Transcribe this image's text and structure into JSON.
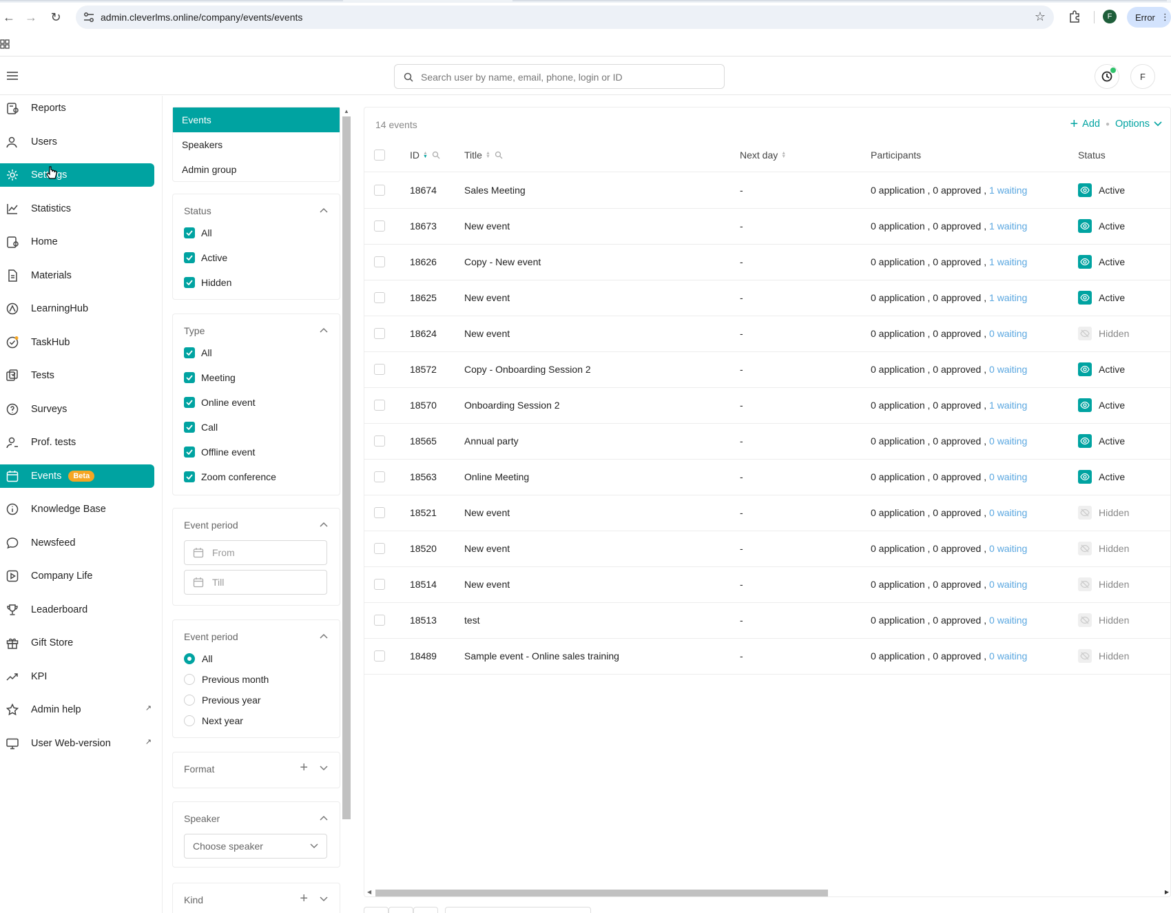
{
  "browser": {
    "url": "admin.cleverlms.online/company/events/events",
    "profile_initial": "F",
    "error_label": "Error"
  },
  "header": {
    "search_placeholder": "Search user by name, email, phone, login or ID",
    "user_initial": "F"
  },
  "sidebar": {
    "items": [
      {
        "label": "Reports",
        "icon": "reports-icon"
      },
      {
        "label": "Users",
        "icon": "users-icon"
      },
      {
        "label": "Settings",
        "icon": "gear-icon"
      },
      {
        "label": "Statistics",
        "icon": "statistics-icon"
      },
      {
        "label": "Home",
        "icon": "home-icon"
      },
      {
        "label": "Materials",
        "icon": "materials-icon"
      },
      {
        "label": "LearningHub",
        "icon": "learninghub-icon"
      },
      {
        "label": "TaskHub",
        "icon": "taskhub-icon"
      },
      {
        "label": "Tests",
        "icon": "tests-icon"
      },
      {
        "label": "Surveys",
        "icon": "surveys-icon"
      },
      {
        "label": "Prof. tests",
        "icon": "prof-tests-icon"
      },
      {
        "label": "Events",
        "icon": "calendar-icon",
        "badge": "Beta"
      },
      {
        "label": "Knowledge Base",
        "icon": "info-icon"
      },
      {
        "label": "Newsfeed",
        "icon": "chat-icon"
      },
      {
        "label": "Company Life",
        "icon": "play-icon"
      },
      {
        "label": "Leaderboard",
        "icon": "trophy-icon"
      },
      {
        "label": "Gift Store",
        "icon": "gift-icon"
      },
      {
        "label": "KPI",
        "icon": "trend-icon"
      },
      {
        "label": "Admin help",
        "icon": "star-icon",
        "external": true
      },
      {
        "label": "User Web-version",
        "icon": "monitor-icon",
        "external": true
      }
    ]
  },
  "filters": {
    "tabs": [
      "Events",
      "Speakers",
      "Admin group"
    ],
    "status": {
      "title": "Status",
      "options": [
        "All",
        "Active",
        "Hidden"
      ]
    },
    "type": {
      "title": "Type",
      "options": [
        "All",
        "Meeting",
        "Online event",
        "Call",
        "Offline event",
        "Zoom conference"
      ]
    },
    "event_period_dates": {
      "title": "Event period",
      "from_placeholder": "From",
      "till_placeholder": "Till"
    },
    "event_period_preset": {
      "title": "Event period",
      "options": [
        "All",
        "Previous month",
        "Previous year",
        "Next year"
      ],
      "selected": "All"
    },
    "format": {
      "title": "Format"
    },
    "speaker": {
      "title": "Speaker",
      "placeholder": "Choose speaker"
    },
    "kind": {
      "title": "Kind"
    }
  },
  "table": {
    "count_label": "14 events",
    "add_label": "Add",
    "options_label": "Options",
    "columns": {
      "id": "ID",
      "title": "Title",
      "next_day": "Next day",
      "participants": "Participants",
      "status": "Status"
    },
    "rows": [
      {
        "id": "18674",
        "title": "Sales Meeting",
        "next_day": "-",
        "p_prefix": "0 application , 0 approved ,",
        "waiting": "1 waiting",
        "status": "Active"
      },
      {
        "id": "18673",
        "title": "New event",
        "next_day": "-",
        "p_prefix": "0 application , 0 approved ,",
        "waiting": "1 waiting",
        "status": "Active"
      },
      {
        "id": "18626",
        "title": "Copy - New event",
        "next_day": "-",
        "p_prefix": "0 application , 0 approved ,",
        "waiting": "1 waiting",
        "status": "Active"
      },
      {
        "id": "18625",
        "title": "New event",
        "next_day": "-",
        "p_prefix": "0 application , 0 approved ,",
        "waiting": "1 waiting",
        "status": "Active"
      },
      {
        "id": "18624",
        "title": "New event",
        "next_day": "-",
        "p_prefix": "0 application , 0 approved ,",
        "waiting": "0 waiting",
        "status": "Hidden"
      },
      {
        "id": "18572",
        "title": "Copy - Onboarding Session 2",
        "next_day": "-",
        "p_prefix": "0 application , 0 approved ,",
        "waiting": "0 waiting",
        "status": "Active"
      },
      {
        "id": "18570",
        "title": "Onboarding Session 2",
        "next_day": "-",
        "p_prefix": "0 application , 0 approved ,",
        "waiting": "1 waiting",
        "status": "Active"
      },
      {
        "id": "18565",
        "title": "Annual party",
        "next_day": "-",
        "p_prefix": "0 application , 0 approved ,",
        "waiting": "0 waiting",
        "status": "Active"
      },
      {
        "id": "18563",
        "title": "Online Meeting",
        "next_day": "-",
        "p_prefix": "0 application , 0 approved ,",
        "waiting": "0 waiting",
        "status": "Active"
      },
      {
        "id": "18521",
        "title": "New event",
        "next_day": "-",
        "p_prefix": "0 application , 0 approved ,",
        "waiting": "0 waiting",
        "status": "Hidden"
      },
      {
        "id": "18520",
        "title": "New event",
        "next_day": "-",
        "p_prefix": "0 application , 0 approved ,",
        "waiting": "0 waiting",
        "status": "Hidden"
      },
      {
        "id": "18514",
        "title": "New event",
        "next_day": "-",
        "p_prefix": "0 application , 0 approved ,",
        "waiting": "0 waiting",
        "status": "Hidden"
      },
      {
        "id": "18513",
        "title": "test",
        "next_day": "-",
        "p_prefix": "0 application , 0 approved ,",
        "waiting": "0 waiting",
        "status": "Hidden"
      },
      {
        "id": "18489",
        "title": "Sample event - Online sales training",
        "next_day": "-",
        "p_prefix": "0 application , 0 approved ,",
        "waiting": "0 waiting",
        "status": "Hidden"
      }
    ]
  },
  "colors": {
    "accent": "#00a3a1",
    "beta": "#f5a623",
    "waiting_link": "#5aa7e0"
  }
}
